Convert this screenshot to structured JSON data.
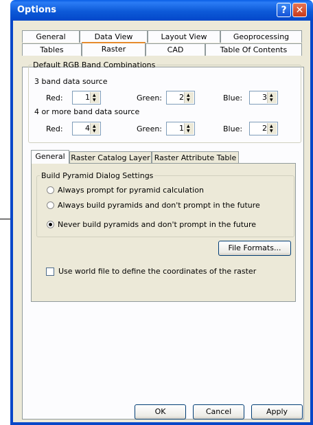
{
  "window": {
    "title": "Options",
    "help_glyph": "?",
    "close_glyph": "✕"
  },
  "tabs_row1": [
    "General",
    "Data View",
    "Layout View",
    "Geoprocessing"
  ],
  "tabs_row2": [
    "Tables",
    "Raster",
    "CAD",
    "Table Of Contents"
  ],
  "selected_tab": "Raster",
  "rgb": {
    "legend": "Default RGB Band Combinations",
    "three_band_label": "3 band data source",
    "four_band_label": "4 or more band data source",
    "red_label": "Red:",
    "green_label": "Green:",
    "blue_label": "Blue:",
    "three": {
      "red": "1",
      "green": "2",
      "blue": "3"
    },
    "four": {
      "red": "4",
      "green": "1",
      "blue": "2"
    }
  },
  "subtabs": [
    "General",
    "Raster Catalog Layer",
    "Raster Attribute Table"
  ],
  "selected_subtab": "General",
  "pyramid": {
    "legend": "Build Pyramid Dialog Settings",
    "options": [
      "Always prompt for pyramid calculation",
      "Always build pyramids and don't prompt in the future",
      "Never build pyramids and don't prompt in the future"
    ],
    "selected_index": 2
  },
  "file_formats_label": "File Formats...",
  "world_file": {
    "label": "Use world file to define the coordinates of the raster",
    "checked": false
  },
  "buttons": {
    "ok": "OK",
    "cancel": "Cancel",
    "apply": "Apply"
  }
}
